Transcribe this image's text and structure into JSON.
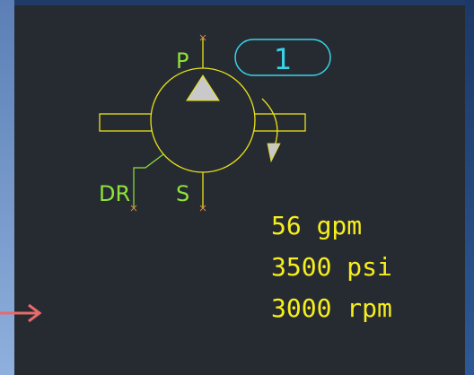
{
  "pump": {
    "pressure_port_label": "P",
    "suction_port_label": "S",
    "drain_port_label": "DR",
    "tag_number": "1"
  },
  "specs": [
    {
      "text": "56 gpm"
    },
    {
      "text": "3500 psi"
    },
    {
      "text": "3000 rpm"
    }
  ],
  "colors": {
    "symbol_line": "#e8e21a",
    "port_label": "#8fe23a",
    "tag": "#38d3e8",
    "canvas": "#262b32",
    "marker": "#e86a6a"
  }
}
